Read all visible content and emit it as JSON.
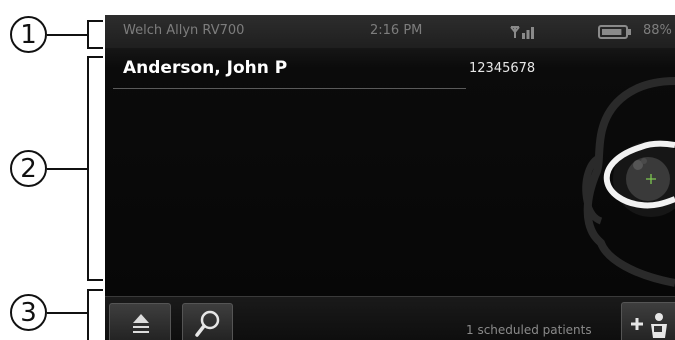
{
  "callouts": [
    "1",
    "2",
    "3"
  ],
  "status_bar": {
    "device": "Welch Allyn RV700",
    "time": "2:16 PM",
    "battery_percent": "88%",
    "wifi_signal_bars": 3,
    "battery_fill": 0.88
  },
  "patient": {
    "name": "Anderson, John P",
    "id": "12345678"
  },
  "bottom_bar": {
    "scheduled_label": "1 scheduled patients"
  },
  "icons": {
    "eject": "eject-icon",
    "search": "search-icon",
    "add_patient": "add-patient-icon",
    "wifi": "wifi-signal-icon",
    "battery": "battery-icon",
    "face": "face-illustration-icon"
  },
  "colors": {
    "screen_bg": "#060606",
    "statusbar_bg": "#262626",
    "status_text": "#7d7d7d",
    "reticle": "#7ec850"
  }
}
